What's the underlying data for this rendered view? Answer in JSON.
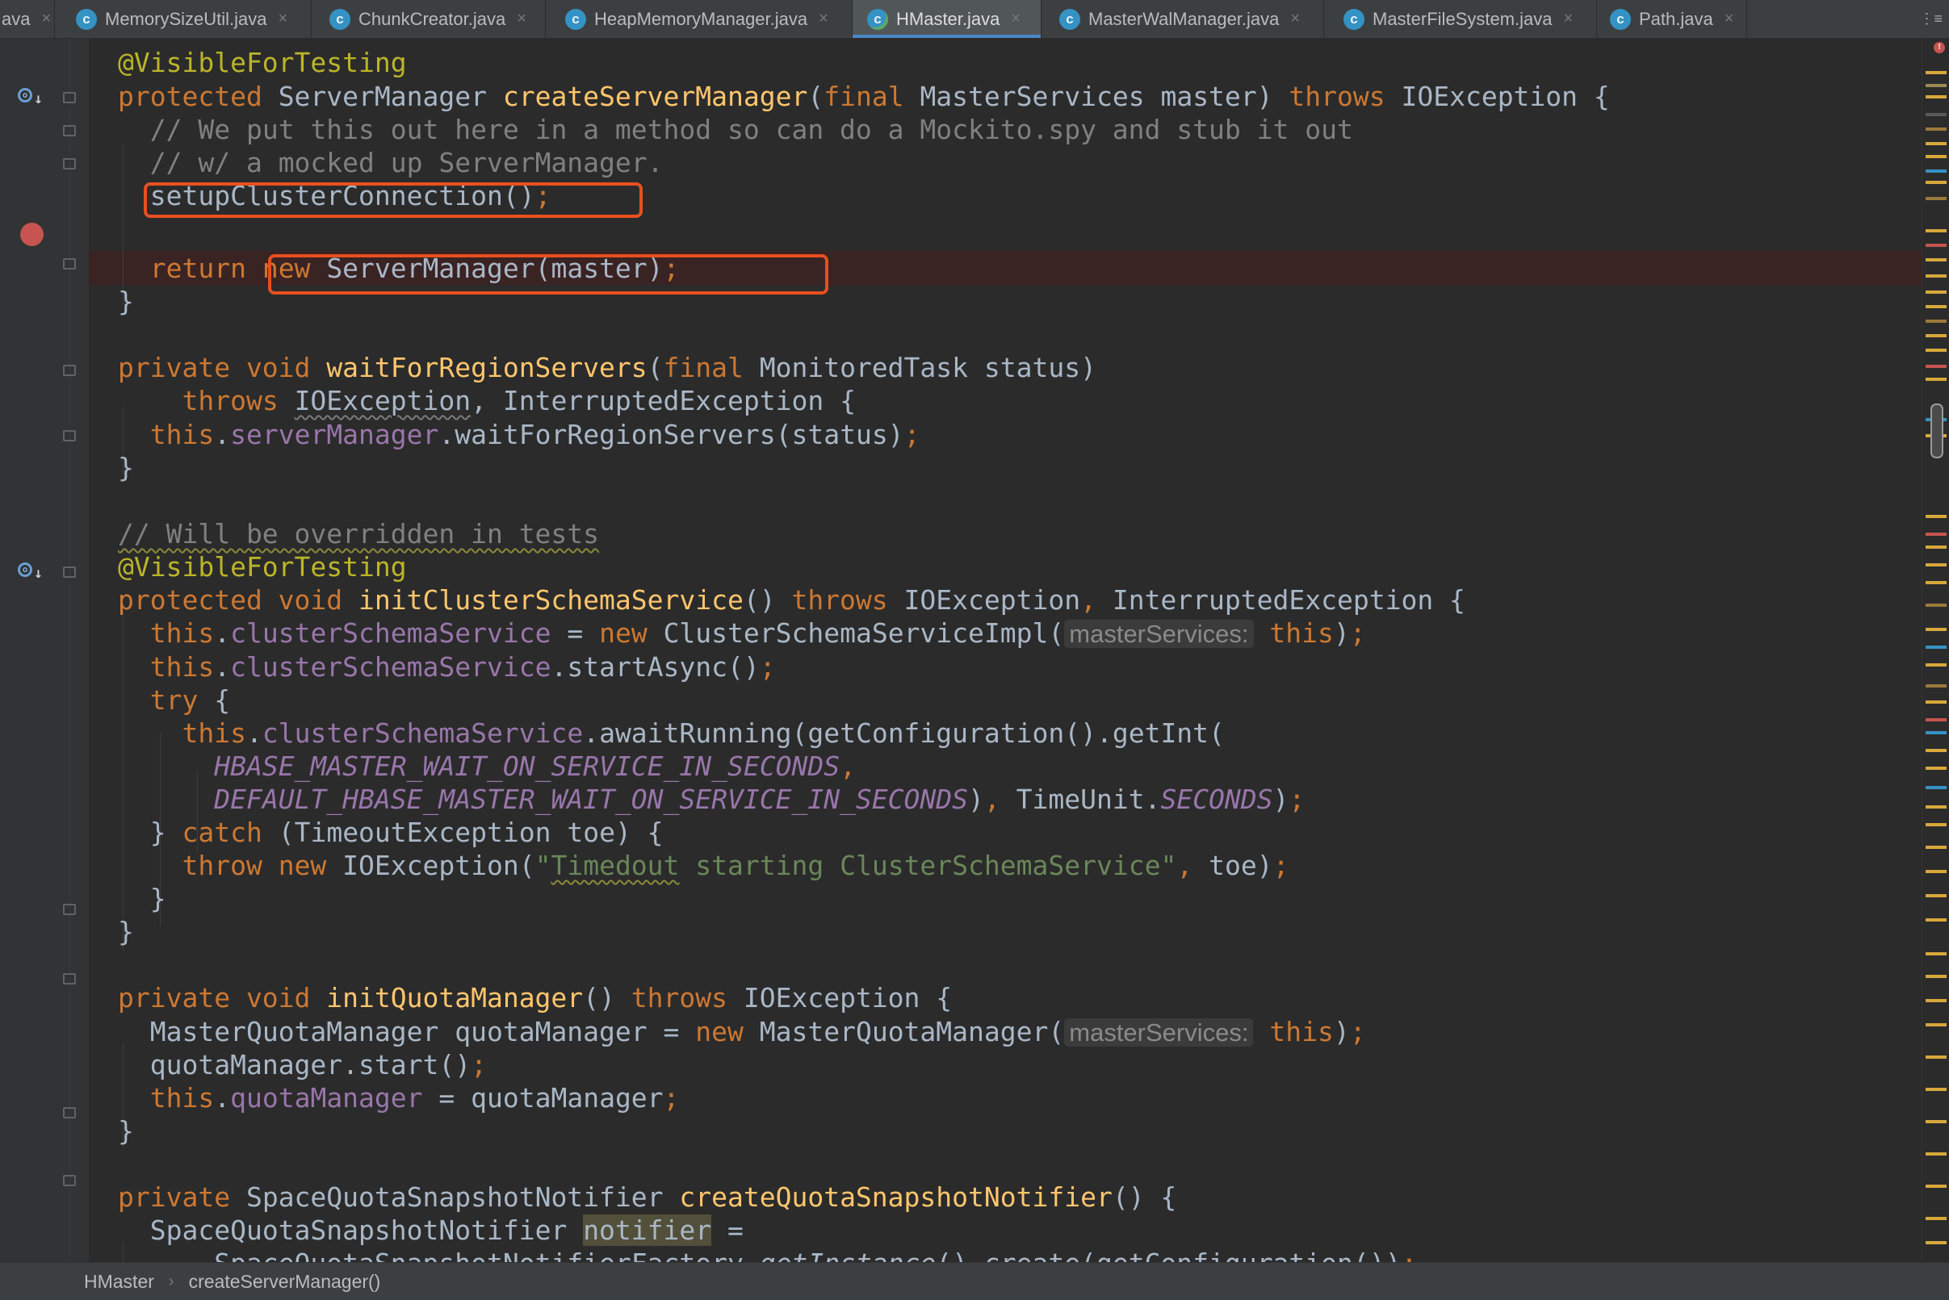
{
  "tabs": [
    {
      "label": "ava",
      "partial": true
    },
    {
      "label": "MemorySizeUtil.java",
      "icon": "c-class-icon"
    },
    {
      "label": "ChunkCreator.java",
      "icon": "c-class-icon"
    },
    {
      "label": "HeapMemoryManager.java",
      "icon": "c-class-icon"
    },
    {
      "label": "HMaster.java",
      "icon": "c-class-run-icon",
      "active": true
    },
    {
      "label": "MasterWalManager.java",
      "icon": "c-class-icon"
    },
    {
      "label": "MasterFileSystem.java",
      "icon": "c-class-icon"
    },
    {
      "label": "Path.java",
      "icon": "c-class-locked-icon"
    }
  ],
  "tab_overflow_label": "⋮≡",
  "code": {
    "l1": {
      "annot": "@VisibleForTesting"
    },
    "l2": {
      "kw1": "protected ",
      "type": "ServerManager ",
      "fn": "createServerManager",
      "p1": "(",
      "kw2": "final ",
      "p2": "MasterServices master) ",
      "kw3": "throws ",
      "p3": "IOException {"
    },
    "l3": {
      "comment": "// We put this out here in a method so can do a Mockito.spy and stub it out"
    },
    "l4": {
      "comment": "// w/ a mocked up ServerManager."
    },
    "l5": {
      "call": "setupClusterConnection()",
      "semi": ";"
    },
    "l6": {
      "kw1": "return ",
      "kw2": "new ",
      "rest": "ServerManager(master)",
      "semi": ";"
    },
    "l7": {
      "text": "}"
    },
    "l9": {
      "kw1": "private void ",
      "fn": "waitForRegionServers",
      "p1": "(",
      "kw2": "final ",
      "p2": "MonitoredTask status)"
    },
    "l10": {
      "kw1": "throws ",
      "ex1": "IOException",
      "p1": ", InterruptedException {"
    },
    "l11": {
      "kw1": "this",
      "p1": ".",
      "field": "serverManager",
      "p2": ".waitForRegionServers(status)",
      "semi": ";"
    },
    "l12": {
      "text": "}"
    },
    "l14": {
      "comment": "// Will be overridden in tests"
    },
    "l15": {
      "annot": "@VisibleForTesting"
    },
    "l16": {
      "kw1": "protected void ",
      "fn": "initClusterSchemaService",
      "p1": "() ",
      "kw2": "throws ",
      "p2": "IOException",
      "comma": ", ",
      "p3": "InterruptedException {"
    },
    "l17": {
      "kw1": "this",
      "p1": ".",
      "field": "clusterSchemaService",
      "p2": " = ",
      "kw2": "new ",
      "p3": "ClusterSchemaServiceImpl(",
      "hint": "masterServices:",
      "kw3": " this",
      "p4": ")",
      "semi": ";"
    },
    "l18": {
      "kw1": "this",
      "p1": ".",
      "field": "clusterSchemaService",
      "p2": ".startAsync()",
      "semi": ";"
    },
    "l19": {
      "kw1": "try ",
      "p1": "{"
    },
    "l20": {
      "kw1": "this",
      "p1": ".",
      "field": "clusterSchemaService",
      "p2": ".awaitRunning(getConfiguration().getInt("
    },
    "l21": {
      "const": "HBASE_MASTER_WAIT_ON_SERVICE_IN_SECONDS",
      "comma": ","
    },
    "l22": {
      "const": "DEFAULT_HBASE_MASTER_WAIT_ON_SERVICE_IN_SECONDS",
      "p1": ")",
      "comma": ", ",
      "p2": "TimeUnit.",
      "const2": "SECONDS",
      "p3": ")",
      "semi": ";"
    },
    "l23": {
      "p1": "} ",
      "kw1": "catch ",
      "p2": "(TimeoutException toe) {"
    },
    "l24": {
      "kw1": "throw new ",
      "p1": "IOException(",
      "s1": "\"",
      "s2": "Timedout",
      "s3": " starting ClusterSchemaService\"",
      "comma": ", ",
      "p2": "toe)",
      "semi": ";"
    },
    "l25": {
      "text": "}"
    },
    "l26": {
      "text": "}"
    },
    "l28": {
      "kw1": "private void ",
      "fn": "initQuotaManager",
      "p1": "() ",
      "kw2": "throws ",
      "p2": "IOException {"
    },
    "l29": {
      "p1": "MasterQuotaManager quotaManager = ",
      "kw1": "new ",
      "p2": "MasterQuotaManager(",
      "hint": "masterServices:",
      "kw2": " this",
      "p3": ")",
      "semi": ";"
    },
    "l30": {
      "p1": "quotaManager.start()",
      "semi": ";"
    },
    "l31": {
      "kw1": "this",
      "p1": ".",
      "field": "quotaManager",
      "p2": " = quotaManager",
      "semi": ";"
    },
    "l32": {
      "text": "}"
    },
    "l34": {
      "kw1": "private ",
      "p1": "SpaceQuotaSnapshotNotifier ",
      "fn": "createQuotaSnapshotNotifier",
      "p2": "() {"
    },
    "l35": {
      "p1": "SpaceQuotaSnapshotNotifier ",
      "var": "notifier",
      "p2": " ="
    },
    "l36": {
      "p1": "SpaceQuotaSnapshotNotifierFactory.",
      "it": "getInstance",
      "p2": "().create(getConfiguration())",
      "semi": ";"
    }
  },
  "breadcrumb": {
    "item1": "HMaster",
    "separator": "›",
    "item2": "createServerManager()"
  },
  "colors": {
    "background": "#2b2b2b",
    "keyword": "#cc7832",
    "annotation": "#bbb529",
    "method": "#ffc66d",
    "comment": "#808080",
    "field": "#9876aa",
    "string": "#6a8759",
    "breakpoint": "#c75450",
    "highlight_box": "#e8501f",
    "active_tab_accent": "#4a88c7"
  }
}
